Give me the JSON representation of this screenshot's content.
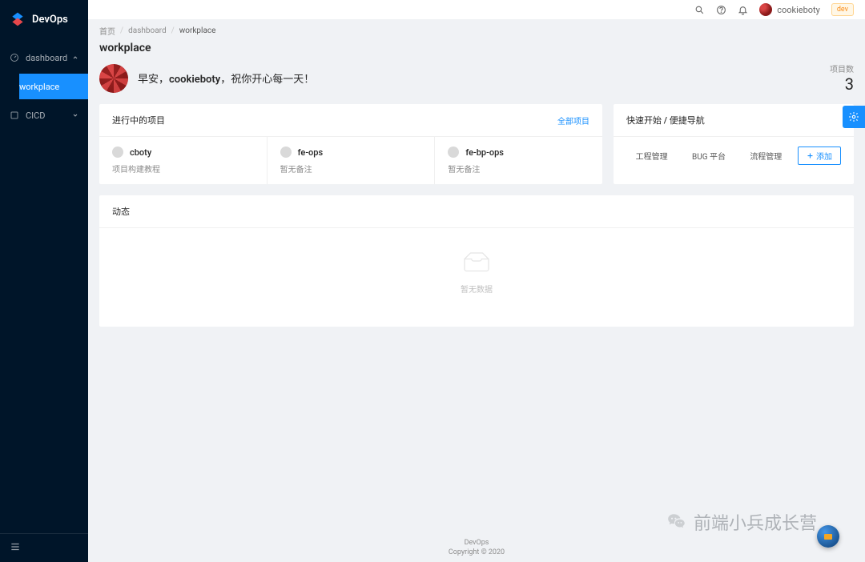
{
  "app": {
    "name": "DevOps"
  },
  "sidebar": {
    "items": [
      {
        "icon": "dashboard",
        "label": "dashboard",
        "expanded": true,
        "children": [
          {
            "label": "workplace"
          }
        ]
      },
      {
        "icon": "cicd",
        "label": "CICD",
        "expanded": false
      }
    ]
  },
  "header": {
    "username": "cookieboty",
    "badge": "dev"
  },
  "breadcrumb": {
    "home": "首页",
    "parent": "dashboard",
    "current": "workplace"
  },
  "page": {
    "title": "workplace",
    "greeting_prefix": "早安，",
    "greeting_name": "cookieboty",
    "greeting_suffix": "，祝你开心每一天！",
    "stat_label": "项目数",
    "stat_value": "3"
  },
  "projects": {
    "title": "进行中的项目",
    "all_link": "全部项目",
    "items": [
      {
        "name": "cboty",
        "desc": "项目构建教程"
      },
      {
        "name": "fe-ops",
        "desc": "暂无备注"
      },
      {
        "name": "fe-bp-ops",
        "desc": "暂无备注"
      }
    ]
  },
  "quicknav": {
    "title": "快速开始 / 便捷导航",
    "links": [
      "工程管理",
      "BUG 平台",
      "流程管理"
    ],
    "add_label": "添加"
  },
  "activity": {
    "title": "动态",
    "empty": "暂无数据"
  },
  "footer": {
    "line1": "DevOps",
    "line2": "Copyright © 2020"
  },
  "watermark": "前端小兵成长营"
}
